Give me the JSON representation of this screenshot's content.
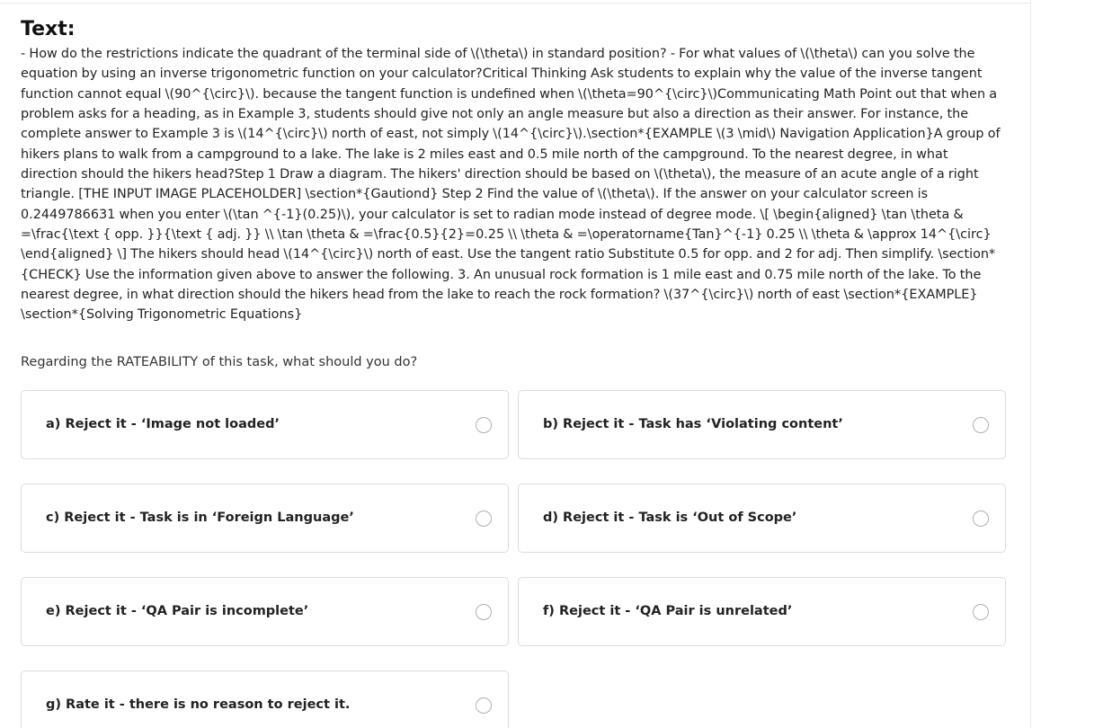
{
  "section": {
    "heading": "Text:",
    "body": "- How do the restrictions indicate the quadrant of the terminal side of \\(\\theta\\) in standard position? - For what values of \\(\\theta\\) can you solve the equation by using an inverse trigonometric function on your calculator?Critical Thinking Ask students to explain why the value of the inverse tangent function cannot equal \\(90^{\\circ}\\). because the tangent function is undefined when \\(\\theta=90^{\\circ}\\)Communicating Math Point out that when a problem asks for a heading, as in Example 3, students should give not only an angle measure but also a direction as their answer. For instance, the complete answer to Example 3 is \\(14^{\\circ}\\) north of east, not simply \\(14^{\\circ}\\).\\section*{EXAMPLE \\(3 \\mid\\) Navigation Application}A group of hikers plans to walk from a campground to a lake. The lake is 2 miles east and 0.5 mile north of the campground. To the nearest degree, in what direction should the hikers head?Step 1 Draw a diagram. The hikers' direction should be based on \\(\\theta\\), the measure of an acute angle of a right triangle. [THE INPUT IMAGE PLACEHOLDER] \\section*{Gautiond} Step 2 Find the value of \\(\\theta\\). If the answer on your calculator screen is 0.2449786631 when you enter \\(\\tan ^{-1}(0.25)\\), your calculator is set to radian mode instead of degree mode. \\[ \\begin{aligned} \\tan \\theta & =\\frac{\\text { opp. }}{\\text { adj. }} \\\\ \\tan \\theta & =\\frac{0.5}{2}=0.25 \\\\ \\theta & =\\operatorname{Tan}^{-1} 0.25 \\\\ \\theta & \\approx 14^{\\circ} \\end{aligned} \\] The hikers should head \\(14^{\\circ}\\) north of east. Use the tangent ratio Substitute 0.5 for opp. and 2 for adj. Then simplify. \\section*{CHECK} Use the information given above to answer the following. 3. An unusual rock formation is 1 mile east and 0.75 mile north of the lake. To the nearest degree, in what direction should the hikers head from the lake to reach the rock formation? \\(37^{\\circ}\\) north of east \\section*{EXAMPLE} \\section*{Solving Trigonometric Equations}"
  },
  "question": "Regarding the RATEABILITY of this task, what should you do?",
  "options": [
    {
      "label": "a) Reject it - ‘Image not loaded’"
    },
    {
      "label": "b) Reject it - Task has ‘Violating content’"
    },
    {
      "label": "c) Reject it - Task is in ‘Foreign Language’"
    },
    {
      "label": "d) Reject it - Task is ‘Out of Scope’"
    },
    {
      "label": "e) Reject it - ‘QA Pair is incomplete’"
    },
    {
      "label": "f) Reject it - ‘QA Pair is unrelated’"
    },
    {
      "label": "g) Rate it - there is no reason to reject it."
    }
  ]
}
